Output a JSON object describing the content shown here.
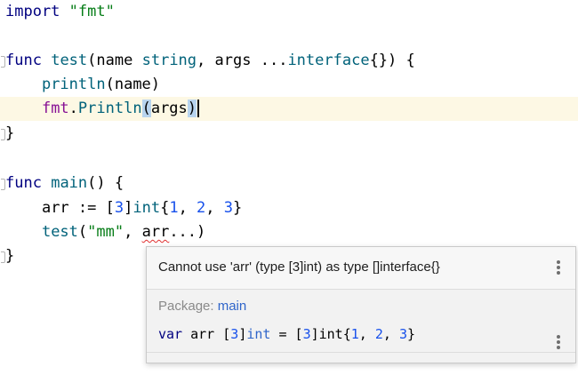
{
  "editor": {
    "line1": {
      "kw": "import",
      "space": " ",
      "str": "\"fmt\""
    },
    "line3": {
      "kw": "func",
      "sp1": " ",
      "name": "test",
      "open": "(",
      "p1": "name",
      "sp2": " ",
      "t1": "string",
      "comma": ", ",
      "p2": "args",
      "sp3": " ",
      "dots": "...",
      "t2": "interface",
      "rest": "{}) {"
    },
    "line4": {
      "indent": "    ",
      "fn": "println",
      "args": "(name)"
    },
    "line5": {
      "indent": "    ",
      "pkg": "fmt",
      "dot": ".",
      "fn": "Println",
      "open": "(",
      "arg": "args",
      "close": ")"
    },
    "line6": {
      "text": "}"
    },
    "line8": {
      "kw": "func",
      "sp": " ",
      "name": "main",
      "rest": "() {"
    },
    "line9": {
      "indent": "    ",
      "a": "arr := [",
      "n1": "3",
      "b": "]",
      "t": "int",
      "c": "{",
      "v1": "1",
      "d1": ", ",
      "v2": "2",
      "d2": ", ",
      "v3": "3",
      "e": "}"
    },
    "line10": {
      "indent": "    ",
      "fn": "test",
      "open": "(",
      "str": "\"mm\"",
      "comma": ", ",
      "err": "arr",
      "rest": "...)"
    },
    "line11": {
      "text": "}"
    }
  },
  "popup": {
    "message": "Cannot use 'arr' (type [3]int) as type []interface{}",
    "package_label": "Package:",
    "package_name": "main",
    "decl": {
      "kw": "var",
      "name": " arr [",
      "n1": "3",
      "b1": "]",
      "typ": "int",
      "eq": " = [",
      "n2": "3",
      "b2": "]int{",
      "v1": "1",
      "s1": ", ",
      "v2": "2",
      "s2": ", ",
      "v3": "3",
      "end": "}"
    }
  }
}
